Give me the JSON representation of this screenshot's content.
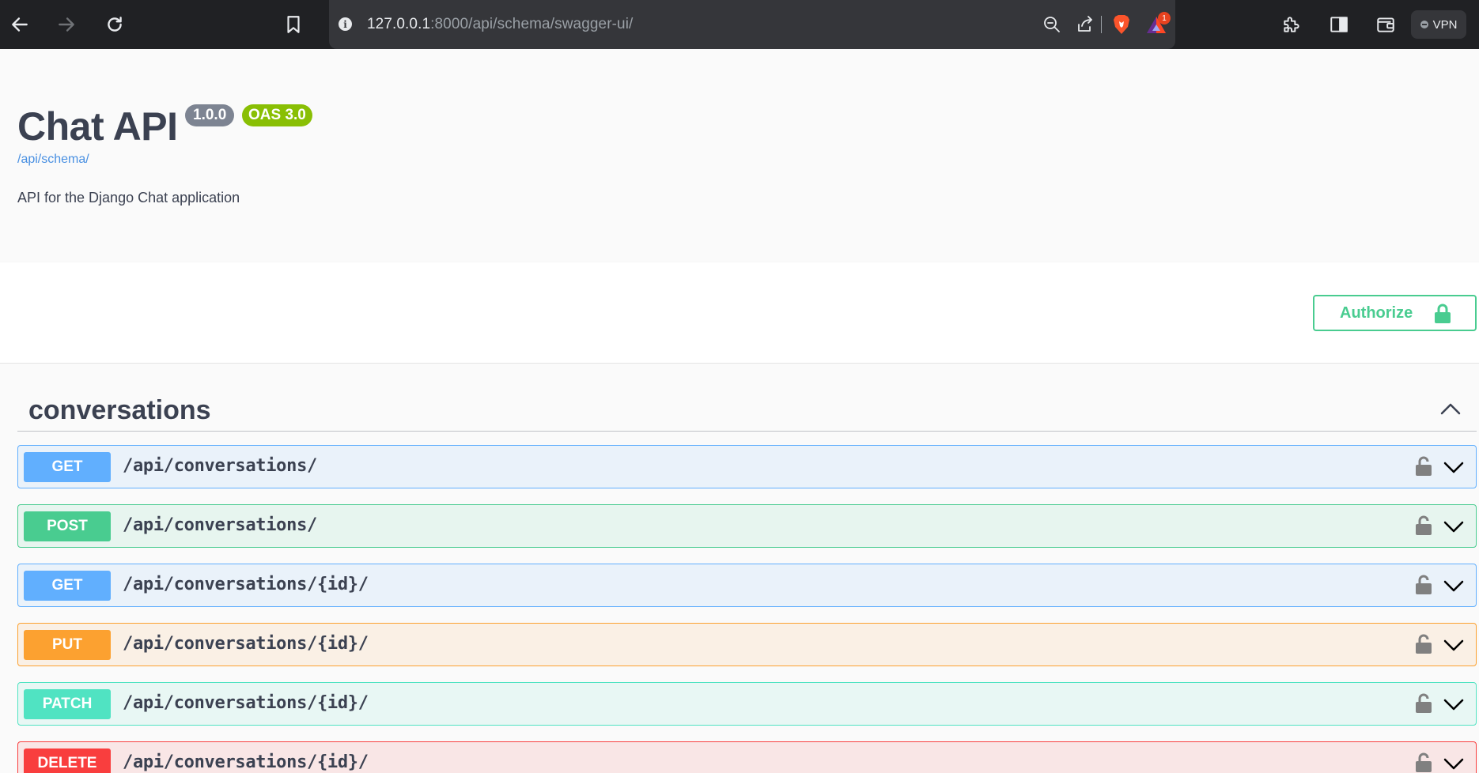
{
  "browser": {
    "url_host": "127.0.0.1",
    "url_rest": ":8000/api/schema/swagger-ui/",
    "rewards_badge": "1",
    "vpn_label": "VPN"
  },
  "info": {
    "title": "Chat API",
    "version": "1.0.0",
    "oas_version": "OAS 3.0",
    "schema_link": "/api/schema/",
    "description": "API for the Django Chat application"
  },
  "auth": {
    "authorize_label": "Authorize"
  },
  "tag": {
    "name": "conversations",
    "expanded": true
  },
  "operations": [
    {
      "method": "GET",
      "path": "/api/conversations/",
      "color": "#61affe"
    },
    {
      "method": "POST",
      "path": "/api/conversations/",
      "color": "#49cc90"
    },
    {
      "method": "GET",
      "path": "/api/conversations/{id}/",
      "color": "#61affe"
    },
    {
      "method": "PUT",
      "path": "/api/conversations/{id}/",
      "color": "#fca130"
    },
    {
      "method": "PATCH",
      "path": "/api/conversations/{id}/",
      "color": "#50e3c2"
    },
    {
      "method": "DELETE",
      "path": "/api/conversations/{id}/",
      "color": "#f93e3e"
    }
  ],
  "colors": {
    "chrome_bg": "#202124",
    "address_bg": "#35363a",
    "authorize_green": "#49cc90",
    "oas_badge": "#89bf04",
    "version_badge": "#7d8492",
    "link_blue": "#4990e2"
  }
}
